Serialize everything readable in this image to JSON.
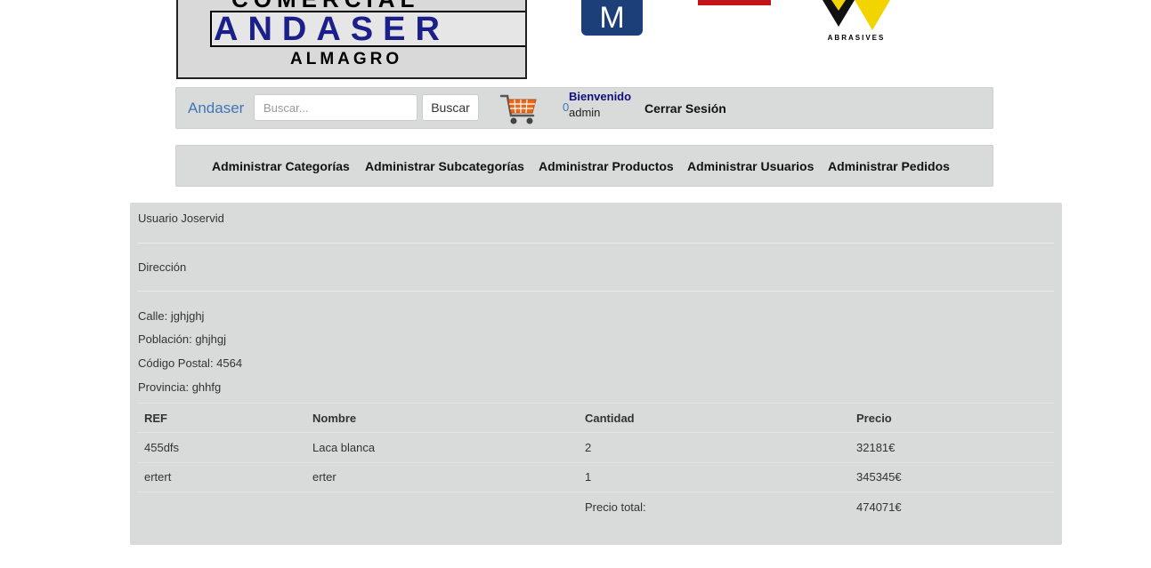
{
  "header": {
    "main_logo": {
      "top_line": "COMERCIAL",
      "brand": "ANDASER",
      "city": "ALMAGRO"
    },
    "logo_m": {
      "letter": "M"
    },
    "logo_sia": {
      "caption": "ABRASIVES"
    }
  },
  "navbar": {
    "brand": "Andaser",
    "search": {
      "placeholder": "Buscar...",
      "value": ""
    },
    "search_button": "Buscar",
    "cart_icon": "shopping-cart-icon",
    "cart_count": "0",
    "welcome": "Bienvenido",
    "username": "admin",
    "logout": "Cerrar Sesión"
  },
  "admin_menu": {
    "items": [
      "Administrar Categorías",
      "Administrar Subcategorías",
      "Administrar Productos",
      "Administrar Usuarios",
      "Administrar Pedidos"
    ]
  },
  "order": {
    "user_line": "Usuario Joservid",
    "address_heading": "Dirección",
    "address": {
      "street": "Calle: jghjghj",
      "town": "Población: ghjhgj",
      "postal": "Código Postal: 4564",
      "province": "Provincia: ghhfg"
    },
    "table": {
      "headers": [
        "REF",
        "Nombre",
        "Cantidad",
        "Precio"
      ],
      "rows": [
        [
          "455dfs",
          "Laca blanca",
          "2",
          "32181€"
        ],
        [
          "ertert",
          "erter",
          "1",
          "345345€"
        ]
      ],
      "total_label": "Precio total:",
      "total_value": "474071€"
    }
  },
  "colors": {
    "nav_bg": "#d9dada",
    "brand_blue": "#3f76b6",
    "welcome_blue": "#10107a",
    "logo_navy": "#1b1f8a"
  }
}
